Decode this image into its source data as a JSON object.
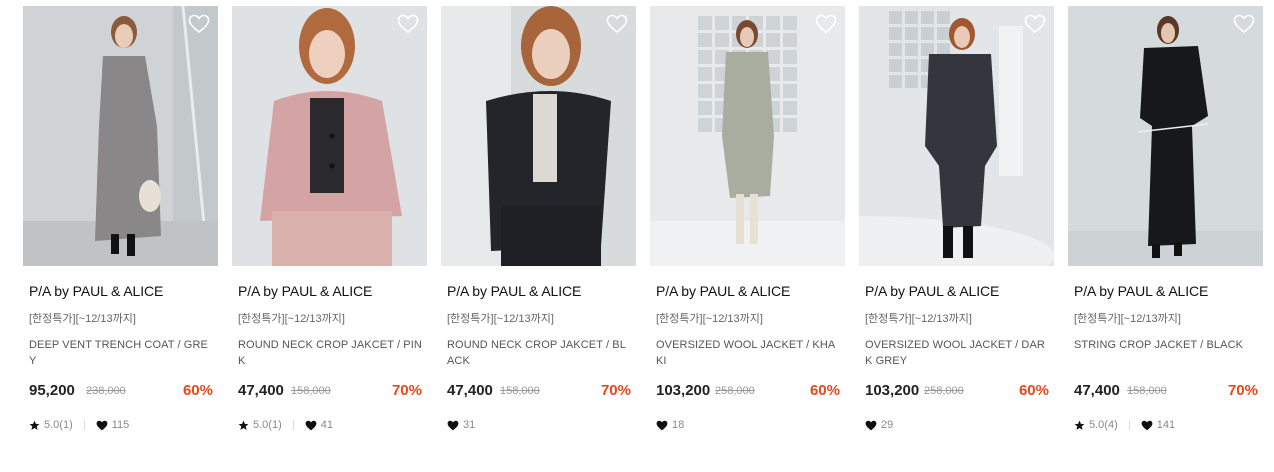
{
  "products": [
    {
      "brand": "P/A by PAUL & ALICE",
      "promo": "[한정특가][~12/13까지]",
      "name": "DEEP VENT TRENCH COAT / GREY",
      "price": "95,200",
      "original_price": "238,000",
      "discount": "60%",
      "rating": "5.0(1)",
      "likes": "115",
      "garment_color": "#8a8789",
      "bg_color": "#cfd3d6"
    },
    {
      "brand": "P/A by PAUL & ALICE",
      "promo": "[한정특가][~12/13까지]",
      "name": "ROUND NECK CROP JAKCET / PINK",
      "price": "47,400",
      "original_price": "158,000",
      "discount": "70%",
      "rating": "5.0(1)",
      "likes": "41",
      "garment_color": "#d3a4a3",
      "bg_color": "#dfe2e4"
    },
    {
      "brand": "P/A by PAUL & ALICE",
      "promo": "[한정특가][~12/13까지]",
      "name": "ROUND NECK CROP JAKCET / BLACK",
      "price": "47,400",
      "original_price": "158,000",
      "discount": "70%",
      "rating": "",
      "likes": "31",
      "garment_color": "#23252a",
      "bg_color": "#d8dbdc"
    },
    {
      "brand": "P/A by PAUL & ALICE",
      "promo": "[한정특가][~12/13까지]",
      "name": "OVERSIZED WOOL JACKET / KHAKI",
      "price": "103,200",
      "original_price": "258,000",
      "discount": "60%",
      "rating": "",
      "likes": "18",
      "garment_color": "#a9ad9f",
      "bg_color": "#e7e9ea"
    },
    {
      "brand": "P/A by PAUL & ALICE",
      "promo": "[한정특가][~12/13까지]",
      "name": "OVERSIZED WOOL JACKET / DARK GREY",
      "price": "103,200",
      "original_price": "258,000",
      "discount": "60%",
      "rating": "",
      "likes": "29",
      "garment_color": "#33373d",
      "bg_color": "#e3e6e8"
    },
    {
      "brand": "P/A by PAUL & ALICE",
      "promo": "[한정특가][~12/13까지]",
      "name": "STRING CROP JACKET / BLACK",
      "price": "47,400",
      "original_price": "158,000",
      "discount": "70%",
      "rating": "5.0(4)",
      "likes": "141",
      "garment_color": "#17181b",
      "bg_color": "#d5dadd"
    }
  ],
  "colors": {
    "discount": "#e8471d",
    "price": "#222222",
    "original_price": "#999999"
  },
  "icons": {
    "wishlist": "heart-outline-icon",
    "rating": "star-icon",
    "likes": "heart-filled-icon"
  }
}
